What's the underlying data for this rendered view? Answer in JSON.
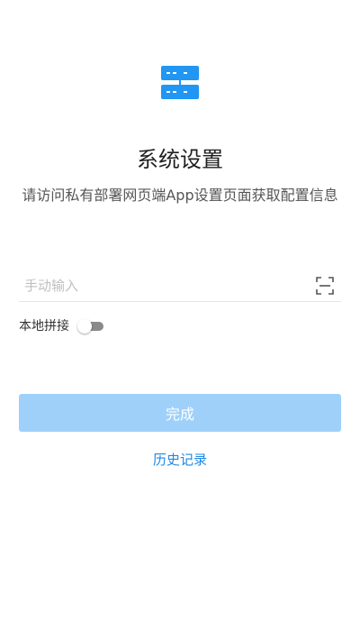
{
  "header": {
    "icon": "server-icon",
    "title": "系统设置",
    "subtitle": "请访问私有部署网页端App设置页面获取配置信息"
  },
  "address_input": {
    "value": "",
    "placeholder": "手动输入",
    "scan_icon": "scan-icon"
  },
  "local_splice": {
    "label": "本地拼接",
    "enabled": false
  },
  "actions": {
    "done_label": "完成",
    "history_label": "历史记录"
  },
  "colors": {
    "brand_blue": "#2196f3",
    "button_disabled": "#9ed0fa",
    "link": "#1e88e5"
  }
}
